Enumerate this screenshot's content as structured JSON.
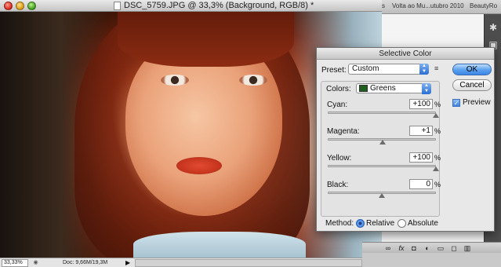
{
  "document": {
    "title": "DSC_5759.JPG @ 33,3% (Background, RGB/8) *",
    "zoom": "33,33%",
    "doc_size": "Doc: 9,66M/19,3M"
  },
  "browser_tabs": [
    {
      "label": "s"
    },
    {
      "label": "Volta ao Mu...utubro 2010"
    },
    {
      "label": "BeautyRo"
    }
  ],
  "dialog": {
    "title": "Selective Color",
    "preset_label": "Preset:",
    "preset_value": "Custom",
    "colors_label": "Colors:",
    "colors_value": "Greens",
    "colors_swatch": "#1f5e1f",
    "sliders": [
      {
        "label": "Cyan:",
        "value": "+100",
        "unit": "%",
        "level": 100
      },
      {
        "label": "Magenta:",
        "value": "+1",
        "unit": "%",
        "level": 1
      },
      {
        "label": "Yellow:",
        "value": "+100",
        "unit": "%",
        "level": 100
      },
      {
        "label": "Black:",
        "value": "0",
        "unit": "%",
        "level": 0
      }
    ],
    "method_label": "Method:",
    "method_relative": "Relative",
    "method_absolute": "Absolute",
    "method_selected": "Relative",
    "ok_label": "OK",
    "cancel_label": "Cancel",
    "preview_label": "Preview",
    "preview_checked": true
  },
  "icons": {
    "gear": "gear-icon",
    "link": "link-icon",
    "fx": "fx",
    "mask": "mask-icon",
    "adjustment": "adjustment-icon",
    "group": "folder-icon",
    "new_layer": "new-layer-icon",
    "trash": "trash-icon"
  }
}
